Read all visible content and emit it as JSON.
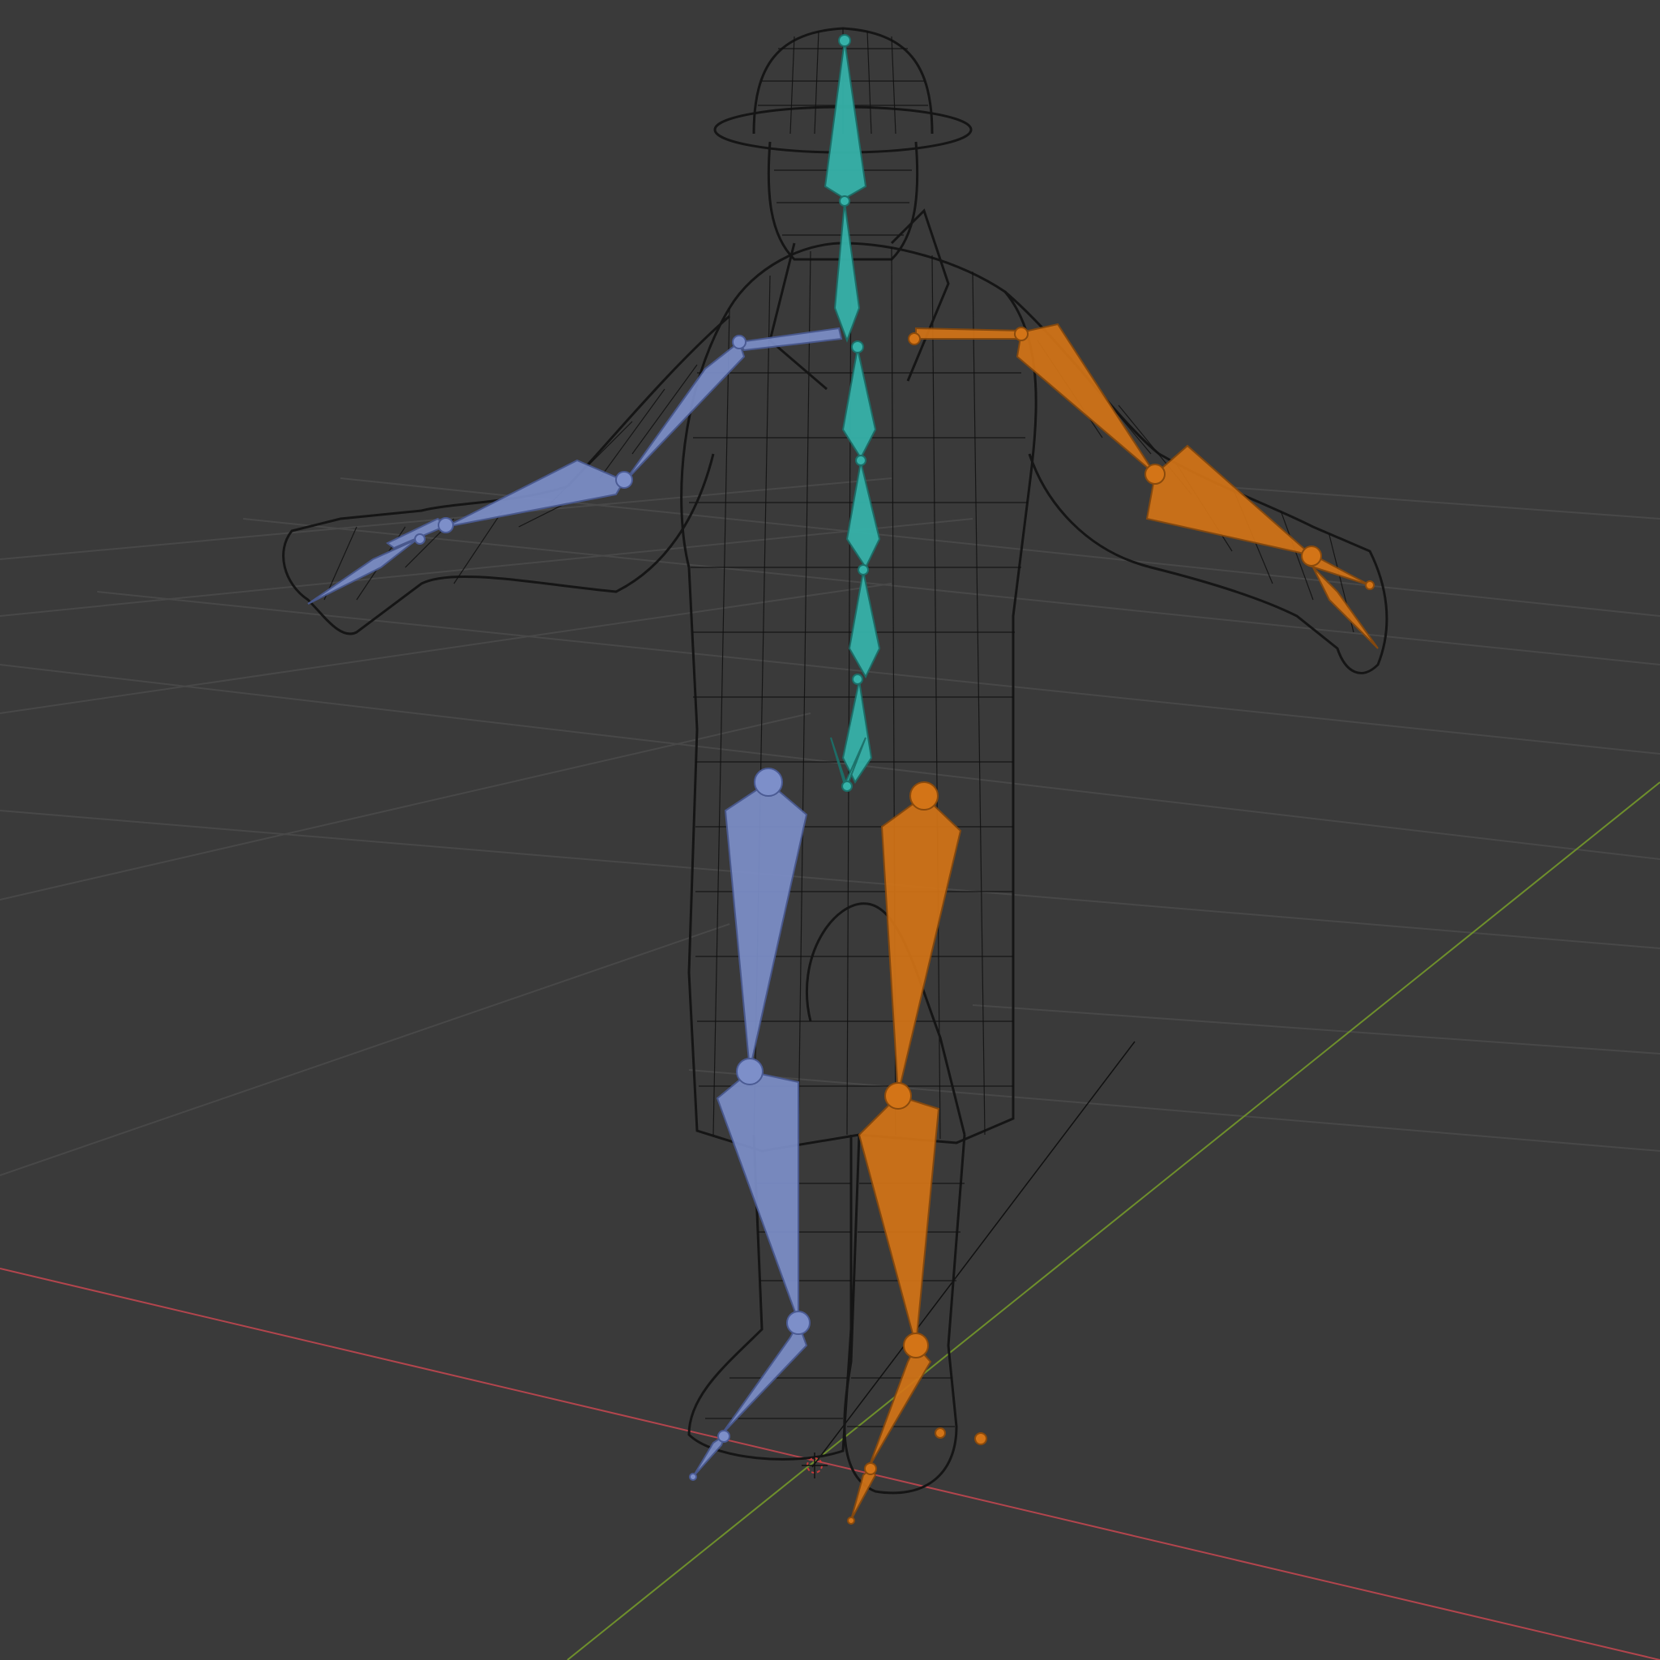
{
  "viewport": {
    "background_color": "#3a3a3a",
    "grid_color": "#484848",
    "x_axis_color": "#b2454d",
    "y_axis_color": "#6e8f2c"
  },
  "mesh": {
    "display": "wireframe",
    "wire_color": "#111111"
  },
  "armature": {
    "left_color": "#7d8fc9",
    "right_color": "#d37417",
    "spine_color": "#36b2a9"
  },
  "icons": {
    "origin": "3d-cursor-icon"
  }
}
